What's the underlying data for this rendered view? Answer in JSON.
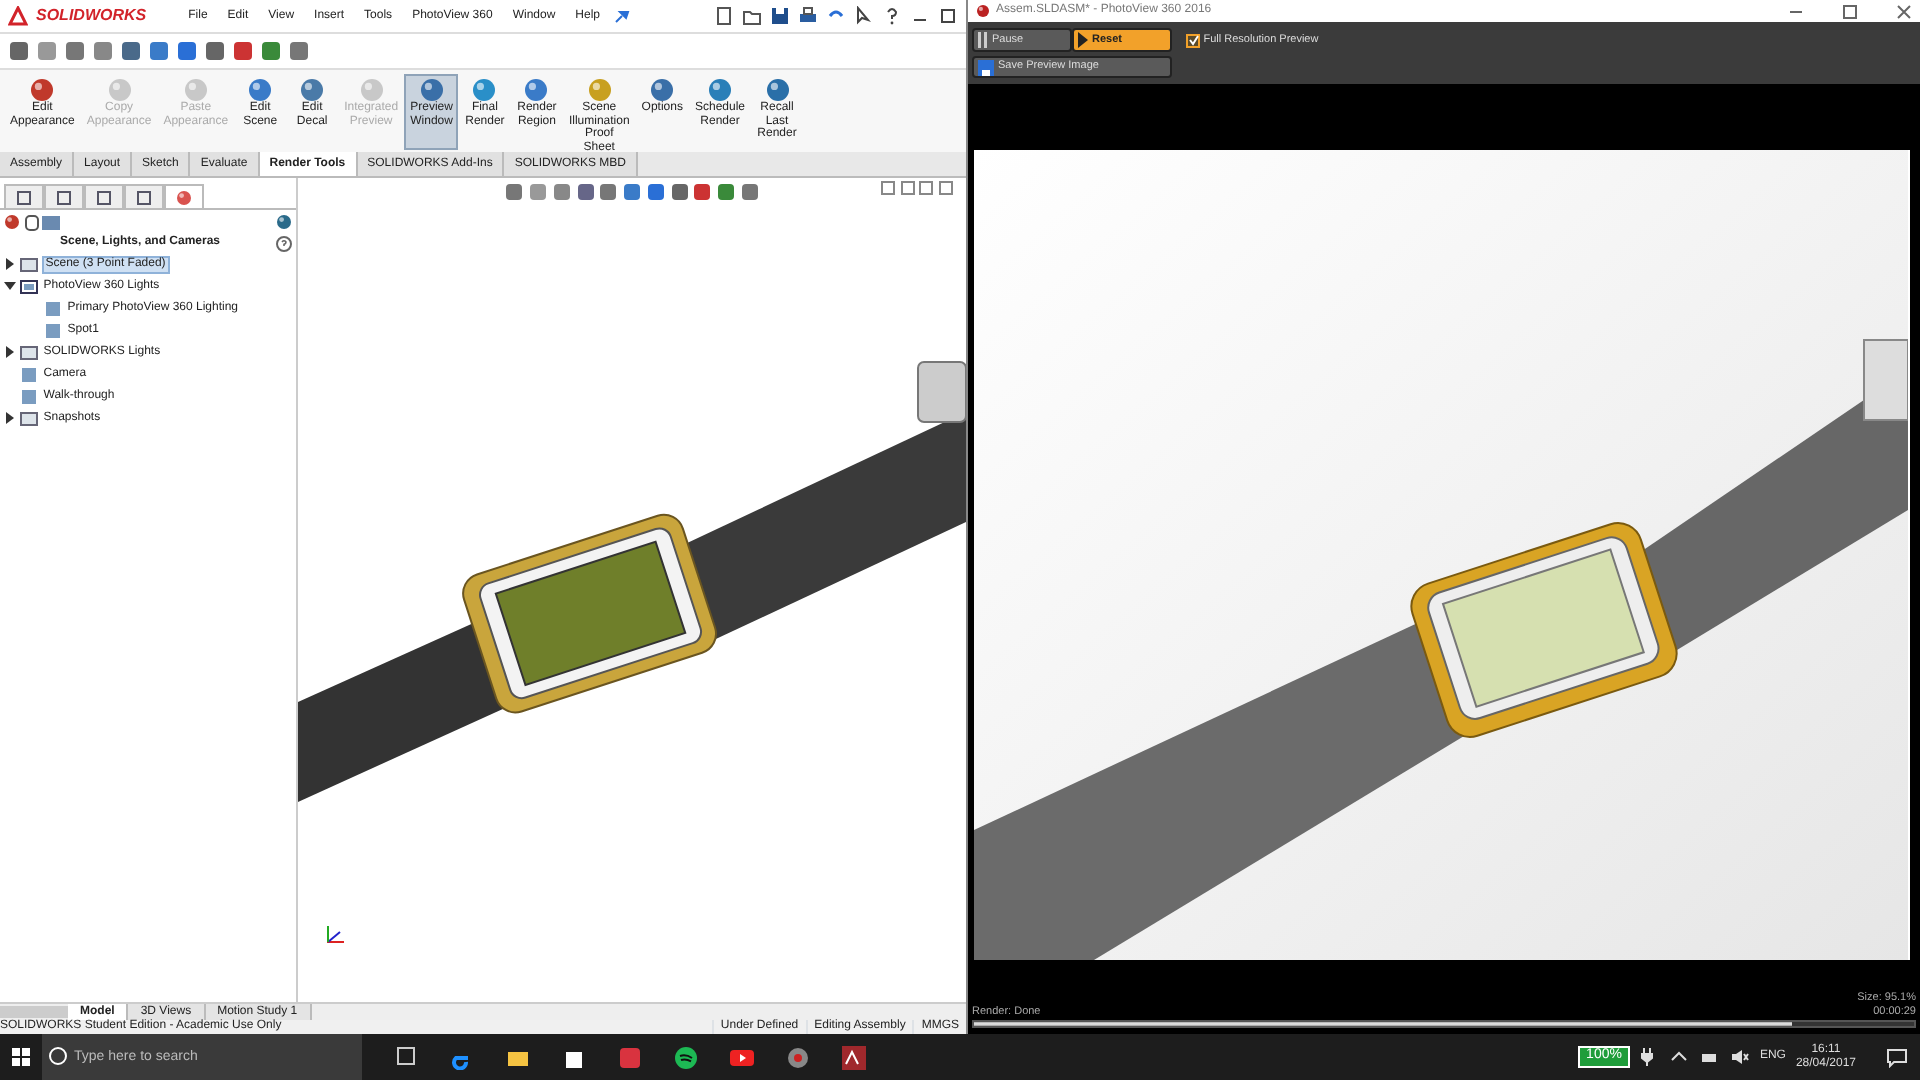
{
  "solidworks": {
    "logo": "SOLIDWORKS",
    "menu": [
      "File",
      "Edit",
      "View",
      "Insert",
      "Tools",
      "PhotoView 360",
      "Window",
      "Help"
    ],
    "ribbon": [
      {
        "label": "Edit Appearance",
        "disabled": false,
        "selected": false
      },
      {
        "label": "Copy Appearance",
        "disabled": true,
        "selected": false
      },
      {
        "label": "Paste Appearance",
        "disabled": true,
        "selected": false
      },
      {
        "label": "Edit Scene",
        "disabled": false,
        "selected": false
      },
      {
        "label": "Edit Decal",
        "disabled": false,
        "selected": false
      },
      {
        "label": "Integrated Preview",
        "disabled": true,
        "selected": false
      },
      {
        "label": "Preview Window",
        "disabled": false,
        "selected": true
      },
      {
        "label": "Final Render",
        "disabled": false,
        "selected": false
      },
      {
        "label": "Render Region",
        "disabled": false,
        "selected": false
      },
      {
        "label": "Scene Illumination Proof Sheet",
        "disabled": false,
        "selected": false
      },
      {
        "label": "Options",
        "disabled": false,
        "selected": false
      },
      {
        "label": "Schedule Render",
        "disabled": false,
        "selected": false
      },
      {
        "label": "Recall Last Render",
        "disabled": false,
        "selected": false
      }
    ],
    "tabs": [
      {
        "label": "Assembly",
        "selected": false
      },
      {
        "label": "Layout",
        "selected": false
      },
      {
        "label": "Sketch",
        "selected": false
      },
      {
        "label": "Evaluate",
        "selected": false
      },
      {
        "label": "Render Tools",
        "selected": true
      },
      {
        "label": "SOLIDWORKS Add-Ins",
        "selected": false
      },
      {
        "label": "SOLIDWORKS MBD",
        "selected": false
      }
    ],
    "panel": {
      "tabs": [
        {
          "selected": false
        },
        {
          "selected": false
        },
        {
          "selected": false
        },
        {
          "selected": false
        },
        {
          "selected": true
        }
      ],
      "title": "Scene, Lights, and Cameras",
      "tree": [
        {
          "label": "Scene (3 Point Faded)",
          "kind": "group",
          "expanded": false,
          "selected": true
        },
        {
          "label": "PhotoView 360 Lights",
          "kind": "group",
          "expanded": true,
          "selected": false,
          "children": [
            {
              "label": "Primary PhotoView 360 Lighting",
              "kind": "item",
              "selected": false
            },
            {
              "label": "Spot1",
              "kind": "item",
              "selected": false
            }
          ]
        },
        {
          "label": "SOLIDWORKS Lights",
          "kind": "group",
          "expanded": false,
          "selected": false
        },
        {
          "label": "Camera",
          "kind": "item",
          "selected": false
        },
        {
          "label": "Walk-through",
          "kind": "item",
          "selected": false
        },
        {
          "label": "Snapshots",
          "kind": "group",
          "expanded": false,
          "selected": false
        }
      ]
    },
    "bottom_tabs": [
      {
        "label": "Model",
        "selected": true
      },
      {
        "label": "3D Views",
        "selected": false
      },
      {
        "label": "Motion Study 1",
        "selected": false
      }
    ],
    "status_bar": [
      "SOLIDWORKS Student Edition - Academic Use Only",
      "Under Defined",
      "Editing Assembly",
      "MMGS"
    ]
  },
  "photoview": {
    "title": "Assem.SLDASM* - PhotoView 360 2016",
    "buttons": [
      {
        "label": "Pause",
        "selected": false
      },
      {
        "label": "Reset",
        "selected": true
      }
    ],
    "save_button": "Save Preview Image",
    "full_resolution": {
      "label": "Full Resolution Preview",
      "checked": true
    },
    "render_status": "Render: Done",
    "size": "Size: 95.1%",
    "elapsed": "00:00:29",
    "progress": {
      "level": 0.87
    }
  },
  "taskbar": {
    "search": {
      "placeholder": "Type here to search"
    },
    "battery": "100%",
    "language": "ENG",
    "time": "16:11",
    "date": "28/04/2017"
  }
}
